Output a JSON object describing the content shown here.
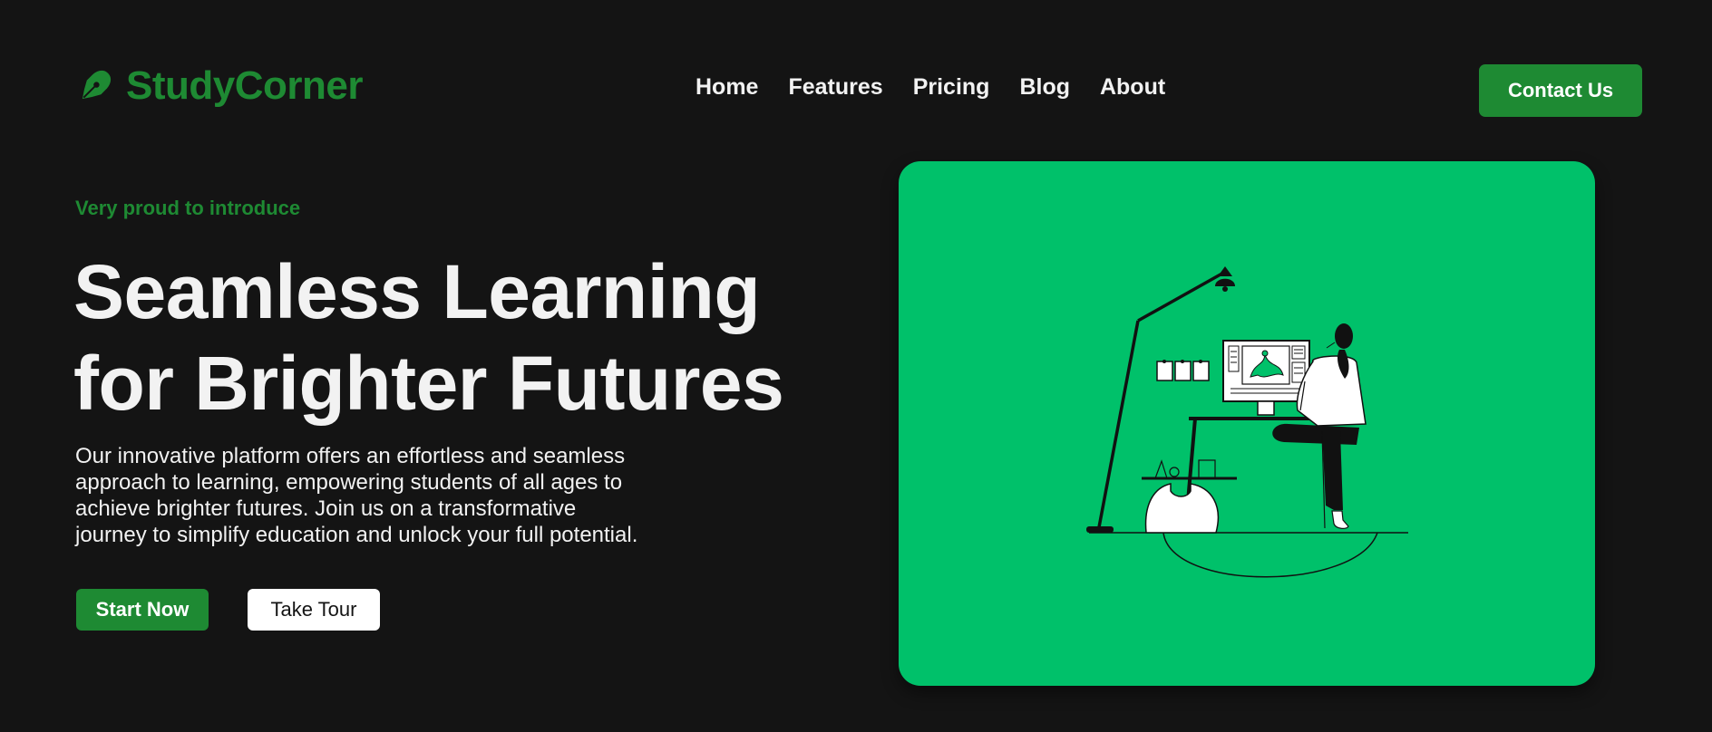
{
  "brand": {
    "name": "StudyCorner",
    "logo_icon": "pen-nib-icon",
    "color": "#1e8a33"
  },
  "nav": {
    "items": [
      {
        "label": "Home"
      },
      {
        "label": "Features"
      },
      {
        "label": "Pricing"
      },
      {
        "label": "Blog"
      },
      {
        "label": "About"
      }
    ],
    "contact_label": "Contact Us"
  },
  "hero": {
    "eyebrow": "Very proud to introduce",
    "headline_lines": [
      "Seamless Learning",
      "for Brighter Futures"
    ],
    "description_lines": [
      "Our innovative platform offers an effortless and seamless",
      "approach to learning, empowering students of all ages to",
      "achieve brighter futures. Join us on a transformative",
      "journey to simplify education and unlock your full potential."
    ],
    "primary_cta": "Start Now",
    "secondary_cta": "Take Tour"
  },
  "illustration": {
    "subject": "person-at-standing-desk-illustration",
    "background_color": "#00c16a"
  },
  "colors": {
    "page_background": "#141414",
    "accent": "#1e8a33",
    "text": "#f2f2f2"
  }
}
